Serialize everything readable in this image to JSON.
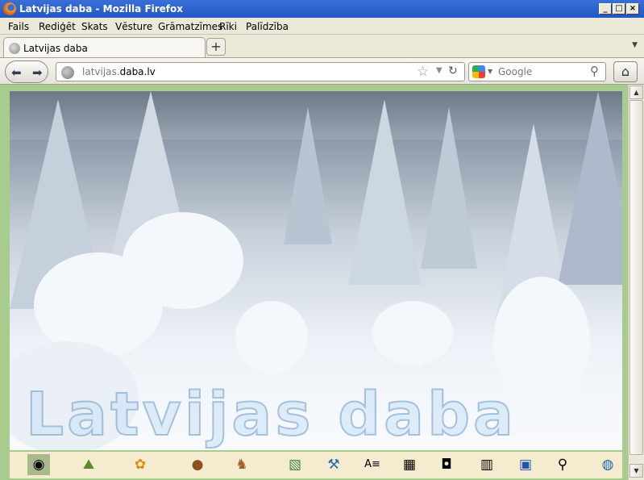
{
  "window": {
    "title": "Latvijas daba - Mozilla Firefox",
    "controls": [
      "minimize",
      "maximize",
      "close"
    ]
  },
  "menubar": {
    "items": [
      "Fails",
      "Rediģēt",
      "Skats",
      "Vēsture",
      "Grāmatzīmes",
      "Rīki",
      "Palīdzība"
    ]
  },
  "tabs": [
    {
      "label": "Latvijas daba",
      "active": true
    }
  ],
  "navbar": {
    "url_prefix": "latvijas.",
    "url_domain": "daba.lv",
    "search_placeholder": "Google"
  },
  "page": {
    "watermark": "Latvijas daba",
    "background_color": "#a8cc8e",
    "iconbar_color": "#f5eccf",
    "icons": [
      {
        "name": "home-globe-icon",
        "glyph": "◉",
        "active": true
      },
      {
        "name": "landscape-icon",
        "glyph": "⛰"
      },
      {
        "name": "flowers-plants-icon",
        "glyph": "✿"
      },
      {
        "name": "mushroom-icon",
        "glyph": "🍄"
      },
      {
        "name": "animals-insects-icon",
        "glyph": "🦌"
      },
      {
        "name": "map-icon",
        "glyph": "▧"
      },
      {
        "name": "axe-icon",
        "glyph": "⚒"
      },
      {
        "name": "alphabet-index-icon",
        "glyph": "A≡"
      },
      {
        "name": "table-icon",
        "glyph": "▦"
      },
      {
        "name": "camera-icon",
        "glyph": "📷"
      },
      {
        "name": "book-icon",
        "glyph": "📖"
      },
      {
        "name": "info-screen-icon",
        "glyph": "ⓘ"
      },
      {
        "name": "search-magnifier-icon",
        "glyph": "🔍"
      },
      {
        "name": "globe-icon",
        "glyph": "🌍"
      }
    ]
  }
}
